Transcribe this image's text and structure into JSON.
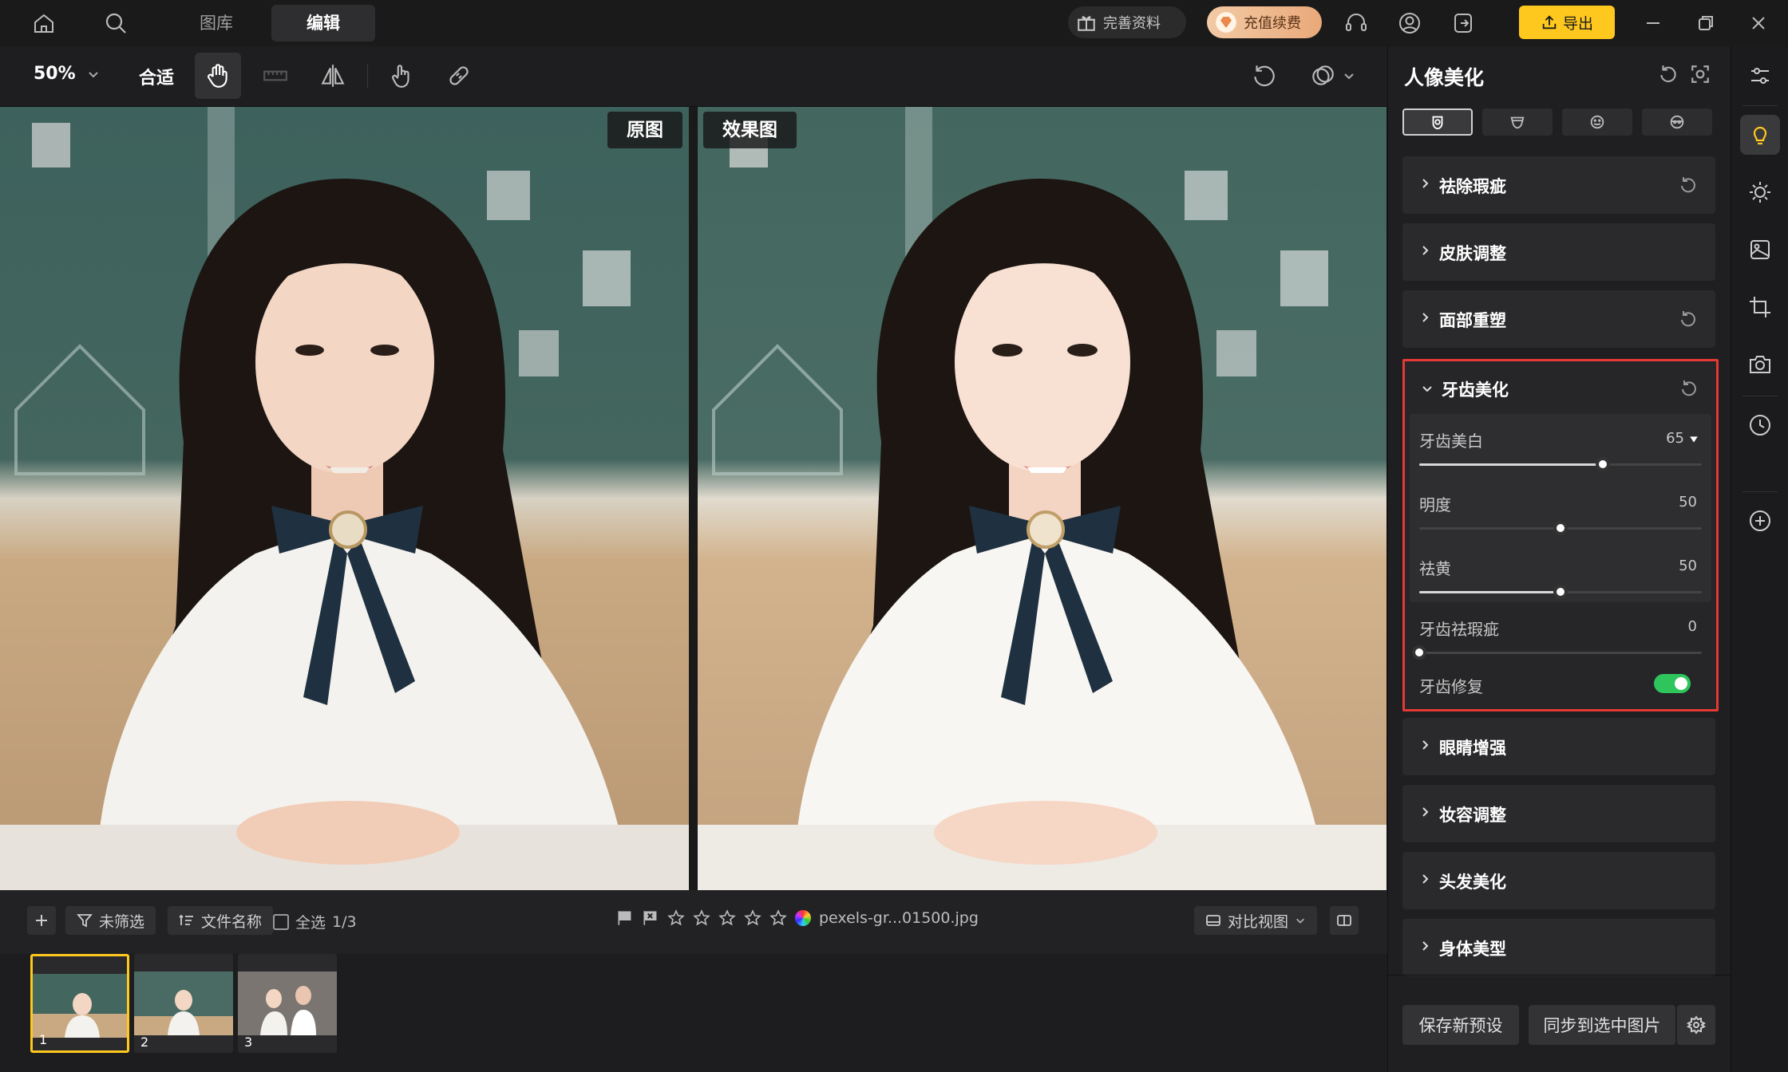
{
  "topbar": {
    "tabs": [
      "图库",
      "编辑"
    ],
    "active_tab": "编辑",
    "profile_label": "完善资料",
    "vip_label": "充值续费",
    "export_label": "导出"
  },
  "toolbar": {
    "zoom": "50%",
    "fit": "合适"
  },
  "canvas": {
    "original_label": "原图",
    "effect_label": "效果图"
  },
  "filmstrip": {
    "filter_label": "未筛选",
    "sort_label": "文件名称",
    "select_all_label": "全选",
    "selection_count": "1/3",
    "filename": "pexels-gr...01500.jpg",
    "compare_view_label": "对比视图",
    "thumb_numbers": [
      "1",
      "2",
      "3"
    ]
  },
  "panel": {
    "title": "人像美化",
    "sections": {
      "blemish": "祛除瑕疵",
      "skin": "皮肤调整",
      "face": "面部重塑",
      "teeth": "牙齿美化",
      "eyes": "眼睛增强",
      "makeup": "妆容调整",
      "hair": "头发美化",
      "body": "身体美型"
    },
    "teeth_controls": {
      "whiten": {
        "label": "牙齿美白",
        "value": "65",
        "fraction": 0.65
      },
      "brightness": {
        "label": "明度",
        "value": "50",
        "fraction": 0.5
      },
      "yellow": {
        "label": "祛黄",
        "value": "50",
        "fraction": 0.5
      },
      "blemish": {
        "label": "牙齿祛瑕疵",
        "value": "0",
        "fraction": 0
      },
      "repair": {
        "label": "牙齿修复",
        "enabled": true
      }
    },
    "save_preset_label": "保存新预设",
    "sync_label": "同步到选中图片"
  },
  "colors": {
    "accent": "#ffc81e",
    "highlight_border": "#e53935",
    "toggle_on": "#2ec55c"
  }
}
